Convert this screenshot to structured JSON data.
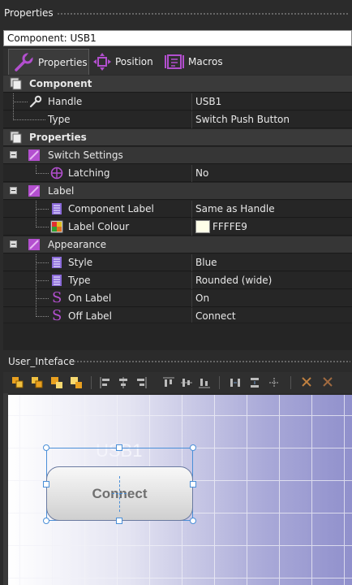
{
  "panel": {
    "title": "Properties"
  },
  "component_select": {
    "value": "Component: USB1"
  },
  "tabs": [
    {
      "label": "Properties",
      "icon": "wrench-icon",
      "active": true
    },
    {
      "label": "Position",
      "icon": "move-icon"
    },
    {
      "label": "Macros",
      "icon": "macro-icon"
    }
  ],
  "grid": {
    "component": {
      "label": "Component",
      "rows": [
        {
          "name": "Handle",
          "value": "USB1"
        },
        {
          "name": "Type",
          "value": "Switch Push Button"
        }
      ]
    },
    "properties": {
      "label": "Properties",
      "switch_settings": {
        "label": "Switch Settings",
        "latching": {
          "name": "Latching",
          "value": "No"
        }
      },
      "label_group": {
        "label": "Label",
        "component_label": {
          "name": "Component Label",
          "value": "Same as Handle"
        },
        "label_colour": {
          "name": "Label Colour",
          "value": "FFFFE9",
          "color": "#FFFFE9"
        }
      },
      "appearance": {
        "label": "Appearance",
        "style": {
          "name": "Style",
          "value": "Blue"
        },
        "type": {
          "name": "Type",
          "value": "Rounded (wide)"
        },
        "on_label": {
          "name": "On Label",
          "value": "On"
        },
        "off_label": {
          "name": "Off Label",
          "value": "Connect"
        }
      }
    }
  },
  "ui_panel": {
    "title": "User_Inteface"
  },
  "canvas": {
    "component_label": "USB1",
    "button_text": "Connect"
  },
  "colors": {
    "panel_bg": "#2b2b2b",
    "category_bg": "#3a3a3a",
    "accent_purple": "#b34fcf",
    "selection_handle": "#4a8fd8"
  }
}
